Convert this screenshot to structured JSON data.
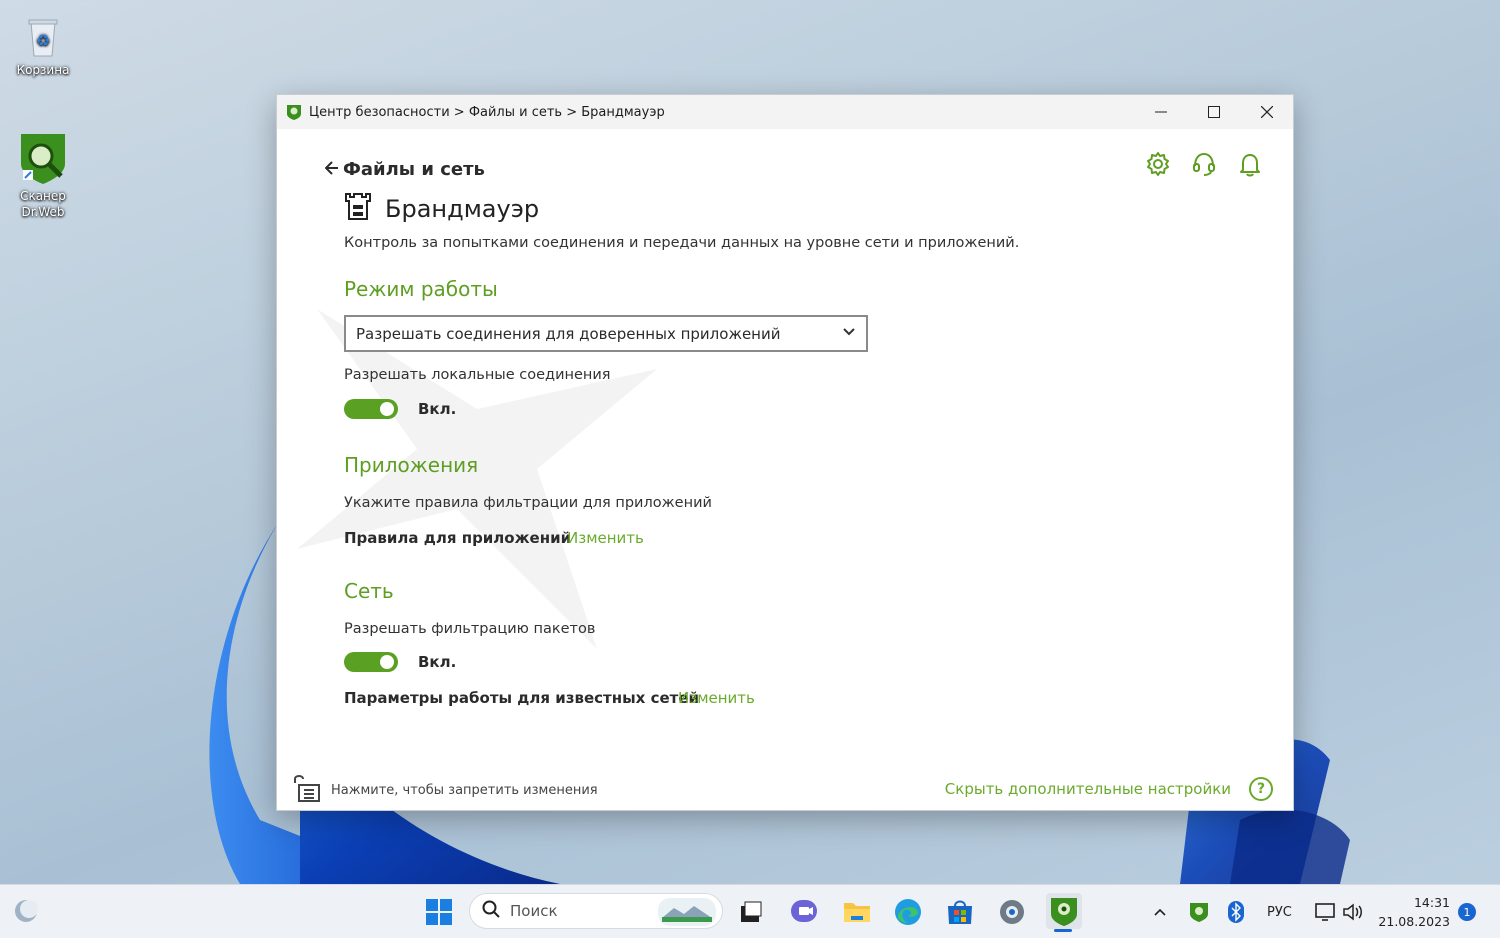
{
  "desktop": {
    "icons": [
      {
        "label": "Корзина"
      },
      {
        "label": "Сканер Dr.Web"
      }
    ]
  },
  "window": {
    "breadcrumb": "Центр безопасности > Файлы и сеть > Брандмауэр",
    "controls": {
      "minimize": "—",
      "maximize": "☐",
      "close": "✕"
    }
  },
  "header": {
    "back_label": "Файлы и сеть",
    "title": "Брандмауэр",
    "description": "Контроль за попытками соединения и передачи данных на уровне сети и приложений."
  },
  "mode": {
    "heading": "Режим работы",
    "selected": "Разрешать соединения для доверенных приложений",
    "local_label": "Разрешать локальные соединения",
    "local_state": "Вкл."
  },
  "apps": {
    "heading": "Приложения",
    "description": "Укажите правила фильтрации для приложений",
    "rules_label": "Правила для приложений",
    "rules_link": "Изменить"
  },
  "network": {
    "heading": "Сеть",
    "packet_label": "Разрешать фильтрацию пакетов",
    "packet_state": "Вкл.",
    "known_label": "Параметры работы для известных сетей",
    "known_link": "Изменить"
  },
  "footer": {
    "lock_text": "Нажмите, чтобы запретить изменения",
    "hide_link": "Скрыть дополнительные настройки",
    "help": "?"
  },
  "taskbar": {
    "search_placeholder": "Поиск",
    "lang": "РУС",
    "time": "14:31",
    "date": "21.08.2023",
    "notifications": "1"
  },
  "colors": {
    "accent": "#5e9e22",
    "link": "#6aaa2c",
    "toggle_on": "#5aa023"
  }
}
